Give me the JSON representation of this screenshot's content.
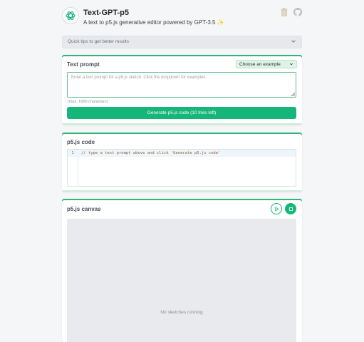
{
  "header": {
    "title": "Text-GPT-p5",
    "subtitle": "A text to p5.js generative editor powered by GPT-3.5 ✨"
  },
  "tips": {
    "label": "Quick tips to get better results"
  },
  "prompt": {
    "title": "Text prompt",
    "example_select": "Choose an example",
    "placeholder": "Enter a text prompt for a p5.js sketch. Click the dropdown for examples.",
    "char_hint": "(max. 1000 characters)",
    "generate_button": "Generate p5.js code (10 tries left)"
  },
  "code": {
    "title": "p5.js code",
    "line_number": "1",
    "line_text": "// type a text prompt above and click 'Generate p5.js code'"
  },
  "canvas": {
    "title": "p5.js canvas",
    "empty_message": "No sketches running"
  },
  "colors": {
    "accent": "#16b67a",
    "background": "#f5f6f8"
  },
  "icons": [
    "openai-logo-icon",
    "trash-icon",
    "github-icon",
    "chevron-down-icon",
    "play-icon",
    "stop-icon"
  ]
}
